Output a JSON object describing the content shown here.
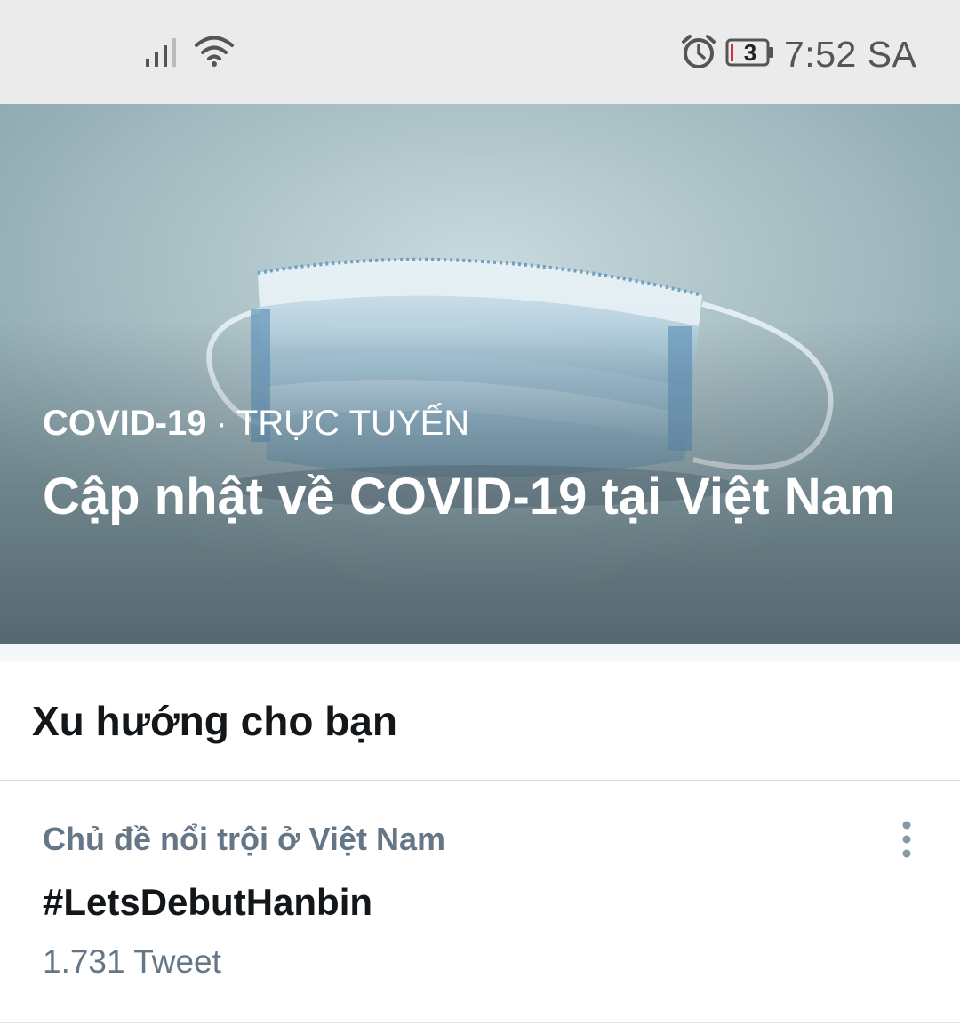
{
  "status_bar": {
    "time": "7:52 SA",
    "battery_level": "3",
    "icons": [
      "signal-icon",
      "wifi-icon",
      "alarm-icon",
      "battery-icon"
    ]
  },
  "hero": {
    "topic": "COVID-19",
    "separator": "·",
    "status": "TRỰC TUYẾN",
    "headline": "Cập nhật về COVID-19 tại Việt Nam",
    "image": "face-mask-photo"
  },
  "trends": {
    "section_title": "Xu hướng cho bạn",
    "items": [
      {
        "context": "Chủ đề nổi trội ở Việt Nam",
        "name": "#LetsDebutHanbin",
        "count": "1.731 Tweet",
        "menu_icon": "more-vertical-icon"
      }
    ]
  },
  "colors": {
    "status_bar_bg": "#ebebeb",
    "primary_text": "#14171a",
    "secondary_text": "#657786",
    "hero_text": "#ffffff"
  }
}
